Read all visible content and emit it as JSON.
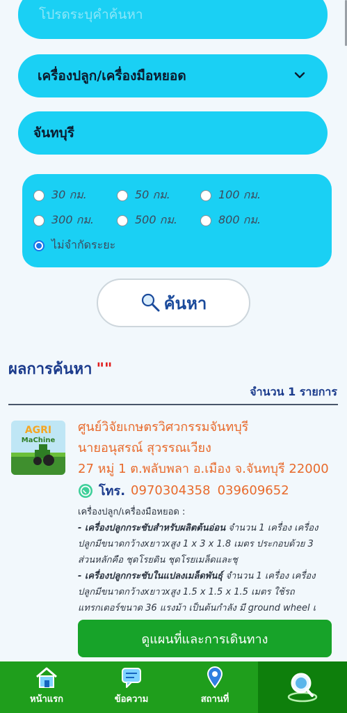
{
  "search": {
    "placeholder": "โปรดระบุคำค้นหา"
  },
  "category": {
    "selected": "เครื่องปลูก/เครื่องมือหยอด"
  },
  "province": {
    "value": "จันทบุรี"
  },
  "radius": {
    "options": [
      "30 กม.",
      "50 กม.",
      "100 กม.",
      "300 กม.",
      "500 กม.",
      "800 กม.",
      "ไม่จำกัดระยะ"
    ],
    "selected": "ไม่จำกัดระยะ"
  },
  "search_button": {
    "label": "ค้นหา"
  },
  "results": {
    "title": "ผลการค้นหา",
    "query": "\"\"",
    "count_text": "จำนวน 1 รายการ",
    "items": [
      {
        "logo_text": [
          "AGRI",
          "MaChine"
        ],
        "name": "ศูนย์วิจัยเกษตรวิศวกรรมจันทบุรี",
        "contact": "นายอนุสรณ์ สุวรรณเวียง",
        "address": "27 หมู่ 1 ต.พลับพลา อ.เมือง จ.จันทบุรี 22000",
        "phone_label": "โทร.",
        "phones": [
          "0970304358",
          "039609652"
        ],
        "desc_heading": "เครื่องปลูก/เครื่องมือหยอด :",
        "desc_item1_title": "- เครื่องปลูกกระชับสำหรับผลิตต้นอ่อน",
        "desc_item1_text": " จำนวน 1 เครื่อง เครื่องปลูกมีขนาดกว้างxยาวxสูง 1 x 3 x 1.8 เมตร ประกอบด้วย 3 ส่วนหลักคือ ชุดโรยดิน ชุดโรยเมล็ดและชุ",
        "desc_item2_title": "- เครื่องปลูกกระชับในแปลงเมล็ดพันธุ์",
        "desc_item2_text": " จำนวน 1 เครื่อง เครื่องปลูกมีขนาดกว้างxยาวxสูง 1.5 x 1.5 x 1.5 เมตร ใช้รถแทรกเตอร์ขนาด 36 แรงม้า เป็นต้นกำลัง มี ground wheel เ",
        "map_button": "ดูแผนที่และการเดินทาง"
      }
    ]
  },
  "nav": [
    {
      "label": "หน้าแรก",
      "icon": "home-icon"
    },
    {
      "label": "ข้อความ",
      "icon": "message-icon"
    },
    {
      "label": "สถานที่",
      "icon": "location-pin-icon"
    },
    {
      "label": "",
      "icon": "map-search-icon",
      "active": true
    }
  ],
  "colors": {
    "field_bg": "#1ad0f4",
    "nav_bg": "#1f9e1c",
    "nav_active_bg": "#0e7f0c",
    "accent_orange": "#e86a2c",
    "title_blue": "#1b3b8c",
    "map_button_bg": "#17a329"
  }
}
